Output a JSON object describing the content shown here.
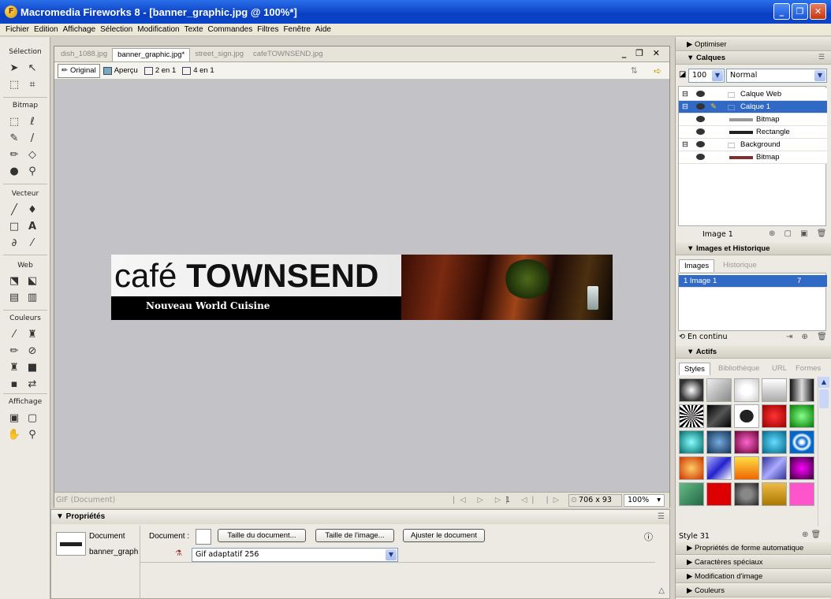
{
  "window": {
    "title": "Macromedia Fireworks 8 - [banner_graphic.jpg @ 100%*]",
    "app_icon": "fireworks-logo-icon"
  },
  "menu": [
    "Fichier",
    "Edition",
    "Affichage",
    "Sélection",
    "Modification",
    "Texte",
    "Commandes",
    "Filtres",
    "Fenêtre",
    "Aide"
  ],
  "tools": {
    "sections": {
      "selection": "Sélection",
      "bitmap": "Bitmap",
      "vector": "Vecteur",
      "web": "Web",
      "colors": "Couleurs",
      "view": "Affichage"
    }
  },
  "document": {
    "tabs": [
      "dish_1088.jpg",
      "banner_graphic.jpg*",
      "street_sign.jpg",
      "cafeTOWNSEND.jpg"
    ],
    "active_tab": 1,
    "view_buttons": {
      "original": "Original",
      "preview": "Aperçu",
      "two_up": "2 en 1",
      "four_up": "4 en 1"
    },
    "banner": {
      "logo_light": "café ",
      "logo_bold": "TOWNSEND",
      "tagline": "Nouveau World Cuisine"
    },
    "status": {
      "format": "GIF (Document)",
      "frame": "1",
      "size": "706 x 93",
      "zoom": "100%"
    }
  },
  "properties": {
    "title": "▼ Propriétés",
    "type": "Document",
    "name": "banner_graph",
    "doc_label": "Document :",
    "btn_canvas": "Taille du document...",
    "btn_image": "Taille de l'image...",
    "btn_fit": "Ajuster le document",
    "palette": "Gif adaptatif 256"
  },
  "panels": {
    "optimize": "▶ Optimiser",
    "layers": {
      "title": "▼ Calques",
      "opacity": "100",
      "blend": "Normal",
      "rows": [
        {
          "label": "Calque Web",
          "kind": "folder"
        },
        {
          "label": "Calque 1",
          "kind": "folder"
        },
        {
          "label": "Bitmap",
          "kind": "object"
        },
        {
          "label": "Rectangle",
          "kind": "object"
        },
        {
          "label": "Background",
          "kind": "folder"
        },
        {
          "label": "Bitmap",
          "kind": "object"
        }
      ],
      "frame_label": "Image 1"
    },
    "frames": {
      "title": "▼ Images et Historique",
      "tab_frames": "Images",
      "tab_history": "Historique",
      "row_label": "1  Image 1",
      "row_delay": "7",
      "loop": "En continu"
    },
    "assets": {
      "title": "▼ Actifs",
      "tabs": [
        "Styles",
        "Bibliothèque",
        "URL",
        "Formes"
      ],
      "style_name": "Style 31"
    },
    "collapsed": [
      "▶ Propriétés de forme automatique",
      "▶ Caractères spéciaux",
      "▶ Modification d'image",
      "▶ Couleurs"
    ]
  }
}
